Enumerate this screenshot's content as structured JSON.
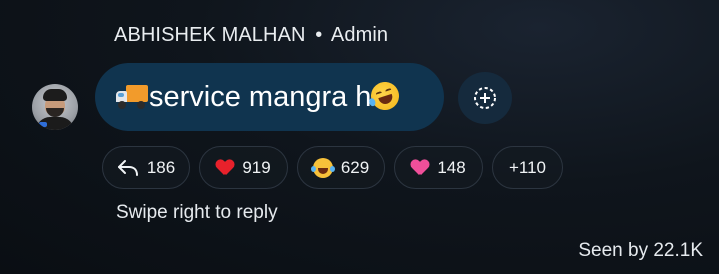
{
  "message": {
    "sender_name": "ABHISHEK MALHAN",
    "separator": "•",
    "sender_role": "Admin",
    "text": "service mangra h",
    "leading_emoji": "delivery-truck",
    "trailing_emoji": "rolling-on-floor-laughing",
    "bubble_color": "#10344f"
  },
  "reactions": [
    {
      "icon": "reply-arrow-icon",
      "count": "186"
    },
    {
      "icon": "red-heart-icon",
      "count": "919"
    },
    {
      "icon": "laughing-tears-icon",
      "count": "629"
    },
    {
      "icon": "pink-heart-icon",
      "count": "148"
    },
    {
      "icon": "",
      "count": "+110"
    }
  ],
  "hint": "Swipe right to reply",
  "seen_by": "Seen by 22.1K"
}
